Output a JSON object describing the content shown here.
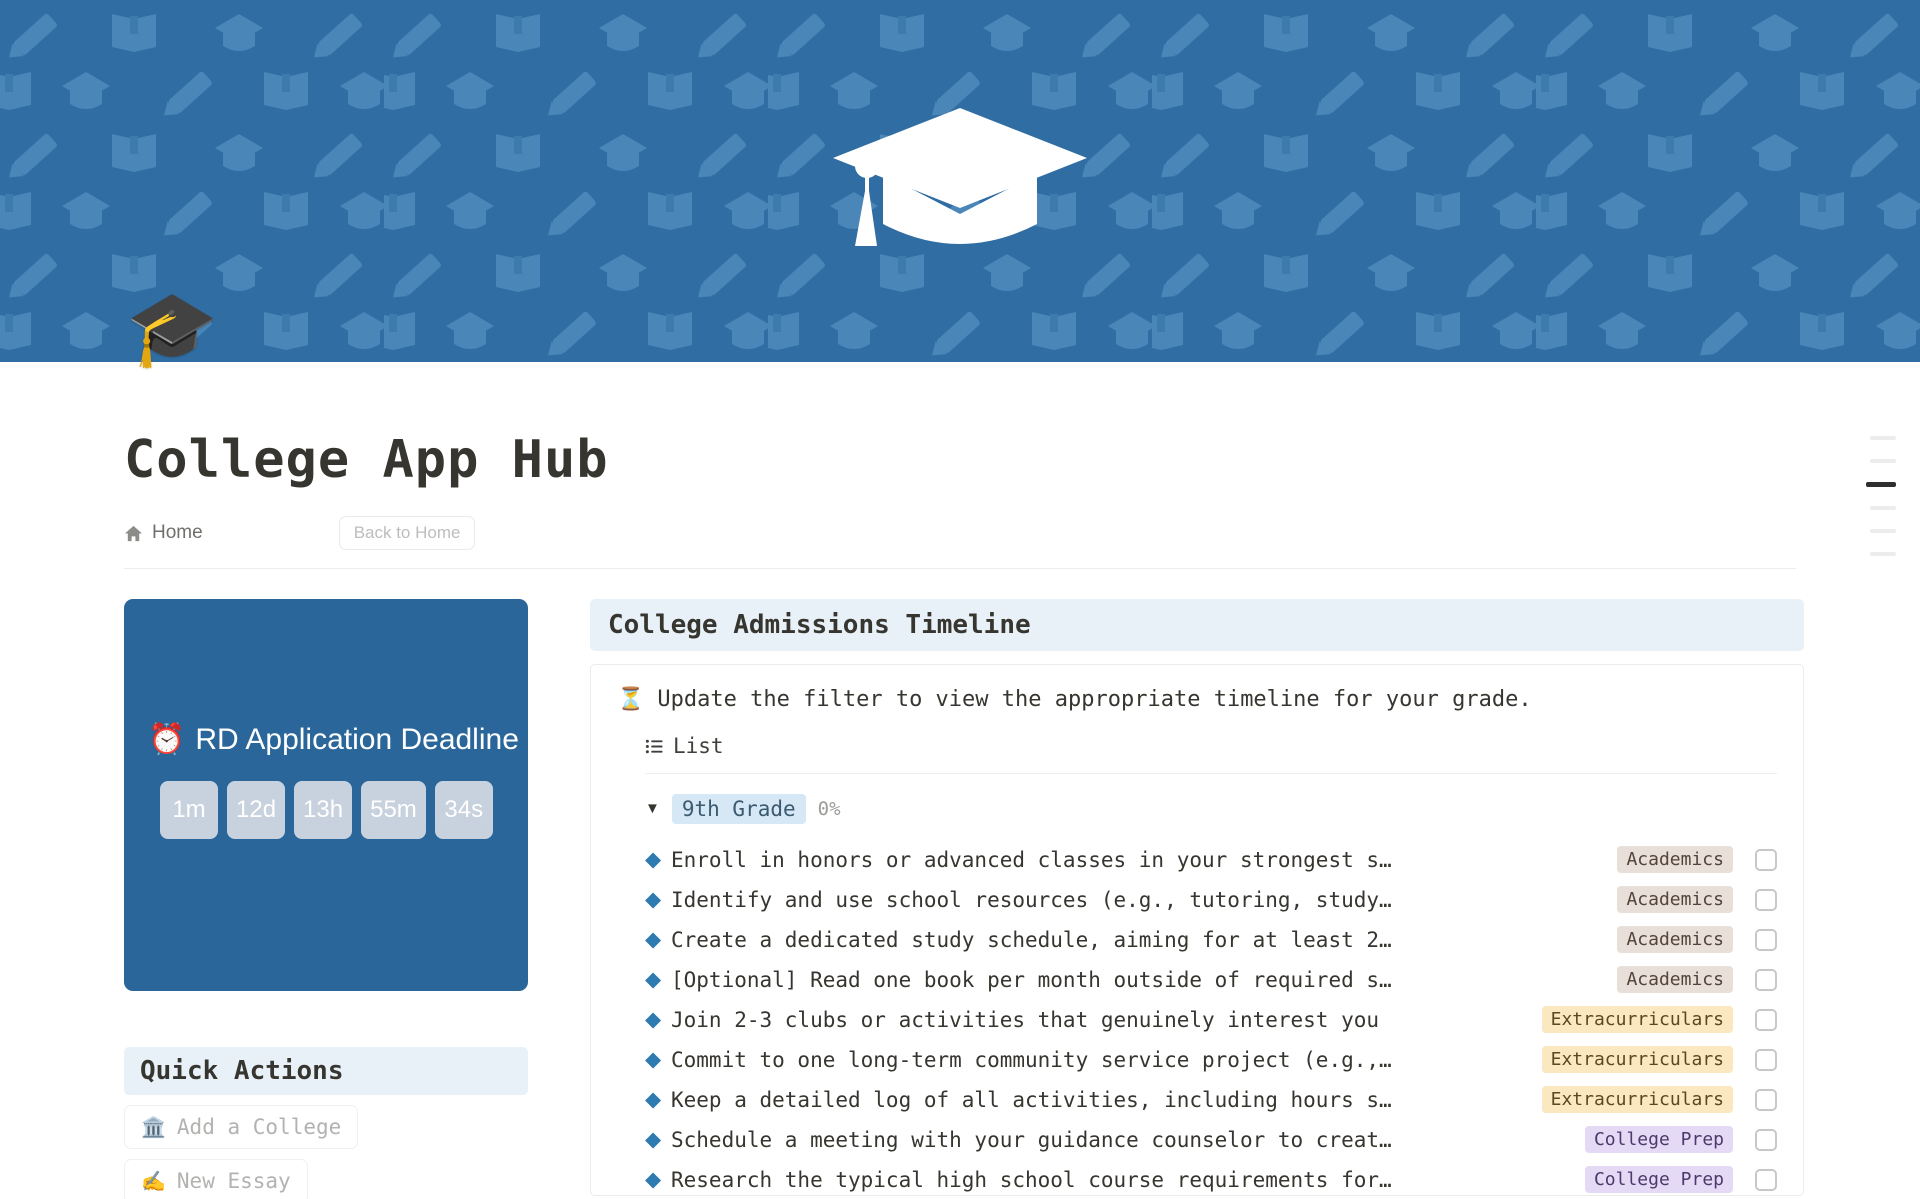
{
  "hero": {
    "center_icon": "graduation-cap-icon",
    "pattern_icons": [
      "pencil-icon",
      "open-book-icon",
      "graduation-cap-icon"
    ],
    "background_color": "#2f6da3"
  },
  "header": {
    "avatar_emoji": "🎓",
    "title": "College App Hub"
  },
  "breadcrumb": {
    "home_label": "Home",
    "back_button_label": "Back to Home"
  },
  "countdown": {
    "icon": "⏰",
    "title": "RD Application Deadline",
    "background_color": "#2a6699",
    "chips": [
      "1m",
      "12d",
      "13h",
      "55m",
      "34s"
    ]
  },
  "quick_actions": {
    "heading": "Quick Actions",
    "items": [
      {
        "icon": "🏛️",
        "label": "Add a College"
      },
      {
        "icon": "✍️",
        "label": "New Essay"
      }
    ]
  },
  "timeline": {
    "heading": "College Admissions Timeline",
    "note_icon": "⏳",
    "note": "Update the filter to view the appropriate timeline for your grade.",
    "tab_label": "List",
    "group": {
      "caret": "▼",
      "label": "9th Grade",
      "progress": "0%"
    },
    "tags": {
      "academics": {
        "label": "Academics",
        "color": "#e9dfd9"
      },
      "extracurriculars": {
        "label": "Extracurriculars",
        "color": "#fbe7c0"
      },
      "college_prep": {
        "label": "College Prep",
        "color": "#e4daf5"
      }
    },
    "tasks": [
      {
        "text": "Enroll in honors or advanced classes in your strongest s…",
        "tag": "Academics",
        "tag_class": "tag-academics",
        "checked": false
      },
      {
        "text": "Identify and use school resources (e.g., tutoring, study…",
        "tag": "Academics",
        "tag_class": "tag-academics",
        "checked": false
      },
      {
        "text": "Create a dedicated study schedule, aiming for at least 2…",
        "tag": "Academics",
        "tag_class": "tag-academics",
        "checked": false
      },
      {
        "text": "[Optional] Read one book per month outside of required s…",
        "tag": "Academics",
        "tag_class": "tag-academics",
        "checked": false
      },
      {
        "text": "Join 2-3 clubs or activities that genuinely interest you",
        "tag": "Extracurriculars",
        "tag_class": "tag-extracurriculars",
        "checked": false
      },
      {
        "text": "Commit to one long-term community service project (e.g.,…",
        "tag": "Extracurriculars",
        "tag_class": "tag-extracurriculars",
        "checked": false
      },
      {
        "text": "Keep a detailed log of all activities, including hours s…",
        "tag": "Extracurriculars",
        "tag_class": "tag-extracurriculars",
        "checked": false
      },
      {
        "text": "Schedule a meeting with your guidance counselor to creat…",
        "tag": "College Prep",
        "tag_class": "tag-collegeprep",
        "checked": false
      },
      {
        "text": "Research the typical high school course requirements for…",
        "tag": "College Prep",
        "tag_class": "tag-collegeprep",
        "checked": false
      }
    ]
  },
  "right_rail": {
    "items": [
      {
        "active": false
      },
      {
        "active": false
      },
      {
        "active": true
      },
      {
        "active": false
      },
      {
        "active": false
      },
      {
        "active": false
      }
    ]
  }
}
